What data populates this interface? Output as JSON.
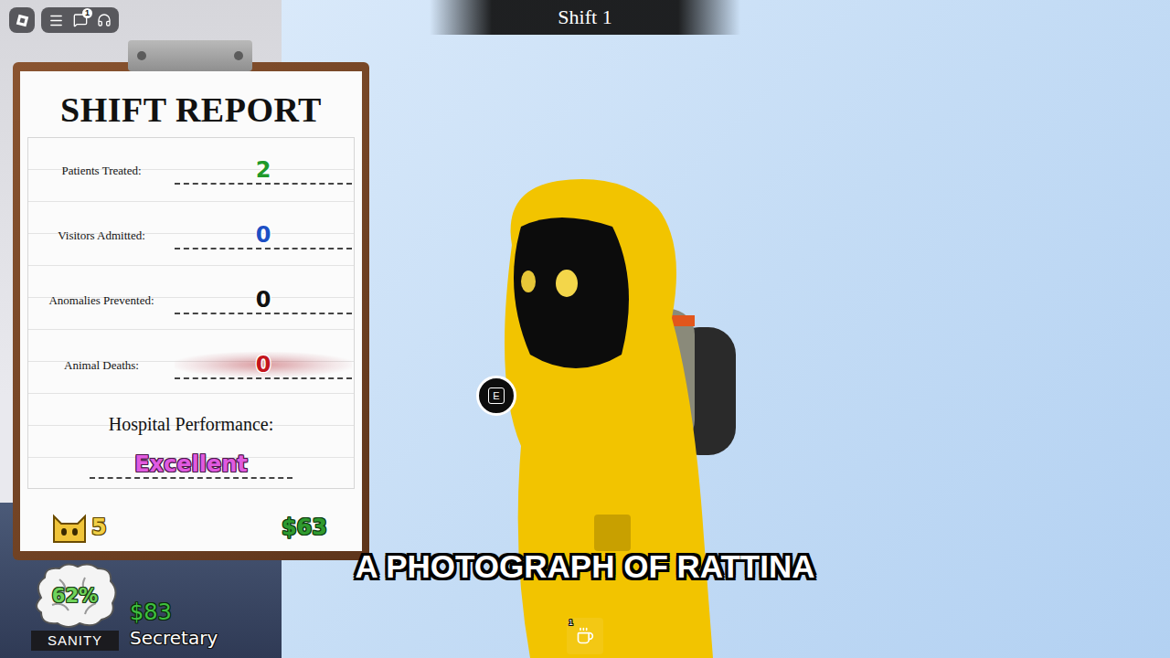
{
  "topbar": {
    "chat_badge": "1"
  },
  "banner": {
    "title": "Shift 1"
  },
  "report": {
    "title": "SHIFT REPORT",
    "rows": [
      {
        "label": "Patients Treated:",
        "value": "2",
        "color": "#1f9a2b",
        "stained": false
      },
      {
        "label": "Visitors Admitted:",
        "value": "0",
        "color": "#1d4fc4",
        "stained": false
      },
      {
        "label": "Anomalies Prevented:",
        "value": "0",
        "color": "#111111",
        "stained": false
      },
      {
        "label": "Animal Deaths:",
        "value": "0",
        "color": "#c4141c",
        "stained": true
      }
    ],
    "performance": {
      "label": "Hospital Performance:",
      "value": "Excellent"
    },
    "cats": "5",
    "money": "$63"
  },
  "hud": {
    "sanity": {
      "reading": "62%",
      "label": "SANITY"
    },
    "cash": "$83",
    "role": "Secretary"
  },
  "prompt": {
    "key": "E"
  },
  "subtitle": "A PHOTOGRAPH OF RATTINA",
  "hotbar": [
    {
      "slot": "1",
      "selected": false
    }
  ]
}
